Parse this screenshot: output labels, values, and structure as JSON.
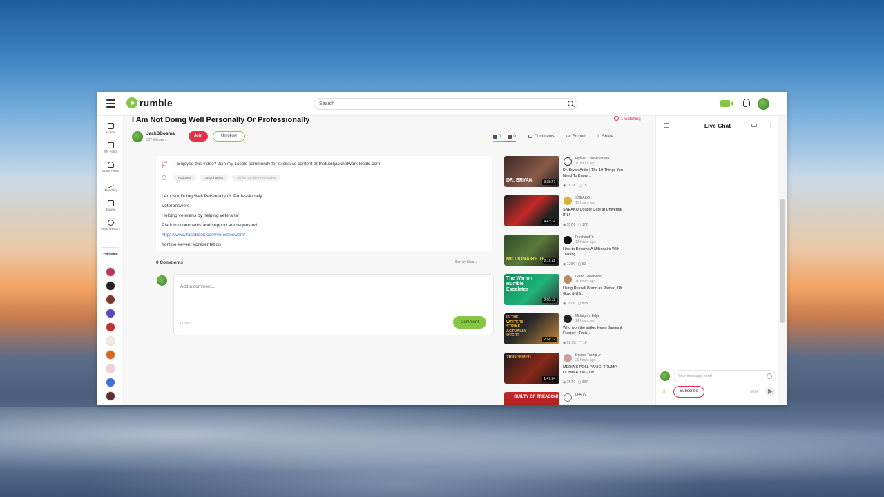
{
  "app": {
    "logo_text": "rumble",
    "brand_color": "#85c742",
    "accent_red": "#e2304c"
  },
  "header": {
    "search_placeholder": "Search"
  },
  "sidebar": {
    "items": [
      {
        "label": "Home",
        "icon": "home-icon"
      },
      {
        "label": "My Feed",
        "icon": "feed-icon"
      },
      {
        "label": "Editor Picks",
        "icon": "trophy-icon"
      },
      {
        "label": "Trending",
        "icon": "trending-icon"
      },
      {
        "label": "Browse",
        "icon": "browse-icon"
      },
      {
        "label": "Watch History",
        "icon": "history-icon"
      }
    ],
    "following_label": "Following"
  },
  "video": {
    "title": "I Am Not Doing Well Personally Or Professionally",
    "watching": "1 watching",
    "channel": "JackBBosma",
    "followers": "337 followers",
    "join_label": "Join",
    "unfollow_label": "Unfollow",
    "likes": "0",
    "dislikes": "0",
    "comments_label": "Comments",
    "embed_label": "Embed",
    "share_label": "Share"
  },
  "description": {
    "locals_text": "Enjoyed this video? Join my Locals community for exclusive content at",
    "locals_link": "thetutorjacknetwork.locals.com",
    "locals_suffix": "!",
    "tags": [
      "Podcasts",
      "Just Chatting",
      "Veriflix Rumble Presentation"
    ],
    "lines": [
      "I Am Not Doing Well Personally Or Professionally",
      "Veteranswers",
      "Helping veterans by helping veterans!",
      "Platform comments and support are requested.",
      "https://www.facebook.com/veteranswers/",
      "#online #event #presentation"
    ]
  },
  "comments": {
    "header": "0 Comments",
    "sort_label": "Sort by likes",
    "placeholder": "Add a comment...",
    "counter": "0/2000",
    "button_label": "Comment"
  },
  "related": [
    {
      "channel": "Flyover Conservatives",
      "ago": "11 hours ago",
      "title": "Dr. Bryan Ardis | The 10 Things You Need To Know…",
      "views": "78.2K",
      "comments": "75",
      "duration": "3:38:27",
      "thumb_text": "DR. BRYAN"
    },
    {
      "channel": "SNEAKO",
      "ago": "15 hours ago",
      "title": "SNEAKO Double Date at Universal IRL!",
      "views": "357K",
      "comments": "172",
      "duration": "4:43:14",
      "thumb_text": ""
    },
    {
      "channel": "FreshandFit",
      "ago": "12 hours ago",
      "title": "How to Become A Millionaire With Trading…",
      "views": "128K",
      "comments": "80",
      "duration": "2:10:11",
      "thumb_text": "MILLIONAIRE TF"
    },
    {
      "channel": "Glenn Greenwald",
      "ago": "16 hours ago",
      "title": "Using Russell Brand as Pretext, UK Govt & US…",
      "views": "187K",
      "comments": "828",
      "duration": "2:00:13",
      "thumb_text": "The War on Rumble Escalates"
    },
    {
      "channel": "Midnight's Edge",
      "ago": "14 hours ago",
      "title": "Who won the strike: Kevin James & Frasier! | Toxic…",
      "views": "59.9K",
      "comments": "16",
      "duration": "2:14:12",
      "thumb_text": "IS THE WRITERS STRIKE ACTUALLY OVER?"
    },
    {
      "channel": "Donald Trump Jr",
      "ago": "20 hours ago",
      "title": "MEDIA'S POLL PANIC: TRUMP DOMINATING, Liv…",
      "views": "287K",
      "comments": "337",
      "duration": "1:47:34",
      "thumb_text": "TRIGGERED"
    },
    {
      "channel": "LFA TV",
      "ago": "",
      "title": "",
      "views": "",
      "comments": "",
      "duration": "",
      "thumb_text": "GUILTY OF TREASON!"
    }
  ],
  "chat": {
    "title": "Live Chat",
    "input_placeholder": "Your message here!",
    "dollar": "$",
    "subscribe_label": "Subscribe",
    "counter": "0/200"
  }
}
